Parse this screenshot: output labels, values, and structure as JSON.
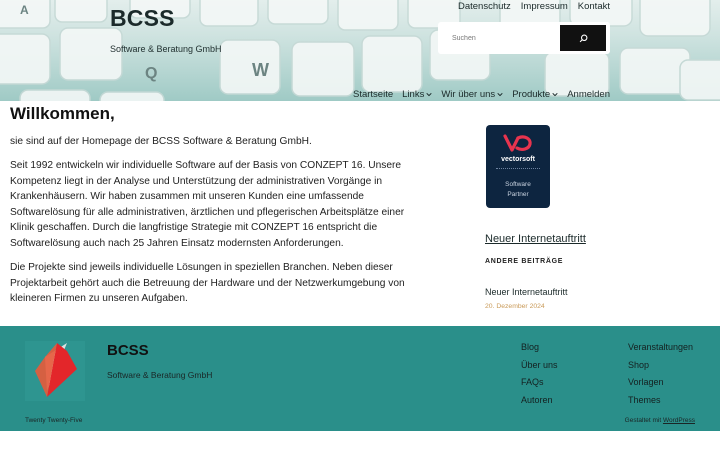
{
  "header": {
    "site_title": "BCSS",
    "tagline": "Software & Beratung GmbH",
    "top_nav": [
      "Datenschutz",
      "Impressum",
      "Kontakt"
    ],
    "search_placeholder": "Suchen",
    "main_nav": [
      {
        "label": "Startseite",
        "dropdown": false
      },
      {
        "label": "Links",
        "dropdown": true
      },
      {
        "label": "Wir über uns",
        "dropdown": true
      },
      {
        "label": "Produkte",
        "dropdown": true
      },
      {
        "label": "Anmelden",
        "dropdown": false
      }
    ],
    "keyboard_keys": [
      "Q",
      "W",
      "A"
    ]
  },
  "content": {
    "title": "Willkommen,",
    "p1": "sie sind auf der Homepage der BCSS Software & Beratung GmbH.",
    "p2_lines": [
      "Seit 1992 entwickeln wir individuelle Software auf der Basis von CONZEPT 16. Unsere",
      "Kompetenz liegt in der Analyse und Unterstützung der administrativen Vorgänge in",
      "Krankenhäusern. Wir haben zusammen mit unseren Kunden eine umfassende",
      "Softwarelösung für alle administrativen, ärztlichen und pflegerischen Arbeitsplätze einer",
      "Klinik geschaffen. Durch die langfristige Strategie mit CONZEPT 16 entspricht die",
      "Softwarelösung auch nach 25 Jahren Einsatz modernsten Anforderungen."
    ],
    "p3_lines": [
      "Die Projekte sind jeweils individuelle Lösungen in speziellen Branchen. Neben dieser",
      "Projektarbeit gehört auch die Betreuung der Hardware und der Netzwerkumgebung von",
      "kleineren Firmen zu unseren Aufgaben."
    ]
  },
  "sidebar": {
    "badge_brand": "vectorsoft",
    "badge_line1": "Software",
    "badge_line2": "Partner",
    "latest_link": "Neuer Internetauftritt",
    "other_heading": "ANDERE BEITRÄGE",
    "post_title": "Neuer Internetauftritt",
    "post_date": "20. Dezember 2024"
  },
  "footer": {
    "title": "BCSS",
    "tagline": "Software & Beratung GmbH",
    "col1": [
      "Blog",
      "Über uns",
      "FAQs",
      "Autoren"
    ],
    "col2": [
      "Veranstaltungen",
      "Shop",
      "Vorlagen",
      "Themes"
    ],
    "theme_name": "Twenty Twenty-Five",
    "credit_prefix": "Gestaltet mit ",
    "credit_link": "WordPress"
  },
  "colors": {
    "header_teal": "#9fcac5",
    "footer_teal": "#2a8f8a",
    "badge_navy": "#0d2540",
    "badge_accent": "#e8344e",
    "date_color": "#c99a58",
    "logo_red": "#e3262a"
  }
}
